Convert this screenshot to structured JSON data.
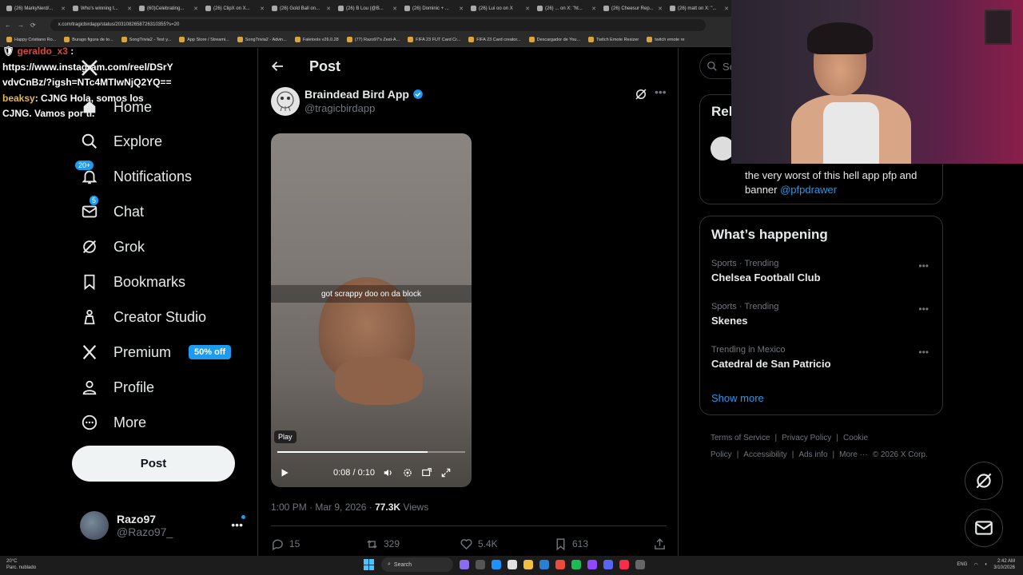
{
  "browser": {
    "tabs": [
      "(26) MarkyNerd/...",
      "Who's winning t...",
      "(60)Celebrating...",
      "(26) ClipX on X...",
      "(26) Gold Ball on...",
      "(26) B Lou (@B...",
      "(26) Dominic + ...",
      "(26) Lui oo on X",
      "(26) ... on X: \"ht...",
      "(26) Cheesur Rep...",
      "(26) matt on X: \"..."
    ],
    "url": "x.com/tragicbirdapp/status/2031082658726310355?s=20",
    "bookmarks": [
      "Happy Cristiano Ro...",
      "Burago figura de to...",
      "SongTrivia2 - Test y...",
      "App Store / Streami...",
      "SongTrivia2 - Advin...",
      "Faletools v26.0.28",
      "(77) Razo97's Zest-A...",
      "FIFA 23 FUT Card Cr...",
      "FIFA 23 Card creator...",
      "Descargador de You...",
      "Twitch Emote Resizer",
      "twitch emote re"
    ]
  },
  "chat": {
    "line1_user": "geraldo_x3",
    "line1_text": "https://www.instagram.com/reel/DSrYvdvCnBz/?igsh=NTc4MTIwNjQ2YQ==",
    "line2_user": "beaksy",
    "line2_text": ": CJNG Hola, somos los CJNG. Vamos por ti."
  },
  "nav": {
    "home": "Home",
    "explore": "Explore",
    "notifications": "Notifications",
    "notifications_badge": "20+",
    "chat": "Chat",
    "chat_badge": "5",
    "grok": "Grok",
    "bookmarks": "Bookmarks",
    "creator_studio": "Creator Studio",
    "premium": "Premium",
    "premium_pill": "50% off",
    "profile": "Profile",
    "more": "More",
    "post_button": "Post"
  },
  "account": {
    "name": "Razo97",
    "handle": "@Razo97_"
  },
  "post": {
    "header": "Post",
    "author_name": "Braindead Bird App",
    "author_handle": "@tragicbirdapp",
    "video_caption": "got scrappy doo on da block",
    "play_label": "Play",
    "time": "0:08 / 0:10",
    "progress": 0.8,
    "timestamp": "1:00 PM · Mar 9, 2026 · ",
    "views_count": "77.3K",
    "views_label": " Views",
    "replies": "15",
    "reposts": "329",
    "likes": "5.4K",
    "bookmarks": "613"
  },
  "right": {
    "search_placeholder": "Search",
    "relevant_header": "Relevant people",
    "relevant_bio": "the very worst of this hell app pfp and banner ",
    "relevant_link": "@pfpdrawer",
    "happening_header": "What’s happening",
    "trends": [
      {
        "category": "Sports · Trending",
        "title": "Chelsea Football Club"
      },
      {
        "category": "Sports · Trending",
        "title": "Skenes"
      },
      {
        "category": "Trending in Mexico",
        "title": "Catedral de San Patricio"
      }
    ],
    "show_more": "Show more",
    "footer": [
      "Terms of Service",
      "|",
      "Privacy Policy",
      "|",
      "Cookie Policy",
      "|",
      "Accessibility",
      "|",
      "Ads info",
      "|",
      "More ···",
      "© 2026 X Corp."
    ]
  },
  "taskbar": {
    "weather_temp": "20°C",
    "weather_desc": "Parc. nublado",
    "search": "Search",
    "lang": "ENG",
    "time": "2:42 AM",
    "date": "3/10/2026"
  },
  "colors": {
    "accent": "#1d9bf0",
    "background": "#000000",
    "muted": "#71767b"
  }
}
